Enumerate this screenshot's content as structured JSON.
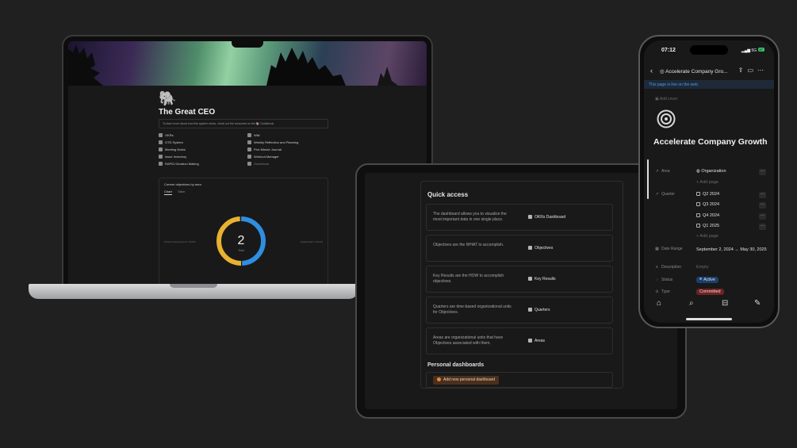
{
  "laptop": {
    "page": {
      "emoji": "🐘",
      "title": "The Great CEO",
      "callout": "To learn more about how this system works, check out the resources on the 📚 Guidebook.",
      "links_left": [
        "OKRs",
        "OTD System",
        "Meeting Notes",
        "Issue Inventory",
        "RAPID Decision Making"
      ],
      "links_right": [
        "Wiki",
        "Weekly Reflection and Planning",
        "Five Minute Journal",
        "Workout Manager",
        "Guidebook"
      ],
      "chart_section": {
        "label": "Current objectives by area",
        "tab_chart": "Chart",
        "tab_table": "Table",
        "donut_number": "2",
        "donut_caption": "Total",
        "left_label": "Product development • 50.0%",
        "right_label": "Organization • 50.0%"
      }
    }
  },
  "chart_data": {
    "type": "pie",
    "categories": [
      "Product development",
      "Organization"
    ],
    "values": [
      1,
      1
    ],
    "center_label": "2",
    "center_caption": "Total",
    "colors": [
      "#e8b130",
      "#2f8ee0"
    ]
  },
  "tablet": {
    "quick_access_title": "Quick access",
    "rows": [
      {
        "desc": "The dashboard allows you to visualize the most important data in one single place.",
        "link": "OKRs Dashboard"
      },
      {
        "desc": "Objectives are the WHAT to accomplish.",
        "link": "Objectives"
      },
      {
        "desc": "Key Results are the HOW to accomplish objectives.",
        "link": "Key Results"
      },
      {
        "desc": "Quarters are time-based organizational units for Objectives.",
        "link": "Quarters"
      },
      {
        "desc": "Areas are organizational units that have Objectives associated with them.",
        "link": "Areas"
      }
    ],
    "personal_title": "Personal dashboards",
    "add_button": "Add new personal dashboard"
  },
  "phone": {
    "time": "07:12",
    "network": "5G",
    "battery": "87",
    "nav_title": "Accelerate Company Gro...",
    "banner": "This page is live on the web.",
    "add_cover": "Add cover",
    "title": "Accelerate Company Growth",
    "props": {
      "area_label": "Area",
      "area_value": "Organization",
      "add_page_1": "+ Add page",
      "quarter_label": "Quarter",
      "quarters": [
        "Q2 2024",
        "Q3 2024",
        "Q4 2024",
        "Q1 2025"
      ],
      "add_page_2": "+ Add page",
      "date_label": "Date Range",
      "date_value": "September 2, 2024 → May 30, 2025",
      "desc_label": "Description",
      "desc_value": "Empty",
      "status_label": "Status",
      "status_value": "Active",
      "type_label": "Type",
      "type_value": "Committed"
    },
    "more": "···"
  }
}
